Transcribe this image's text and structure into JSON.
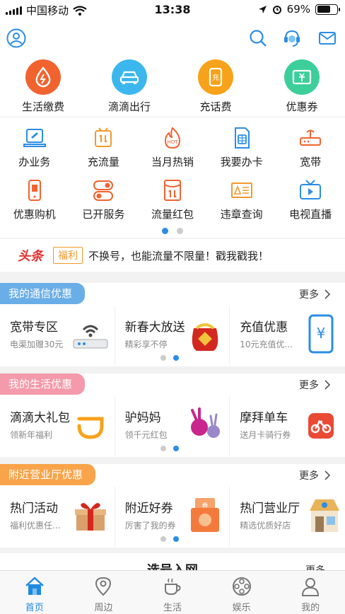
{
  "status_bar": {
    "carrier": "中国移动",
    "time": "13:38",
    "battery": "69%",
    "battery_level": 0.69
  },
  "header": {
    "profile_icon": "user-circle-icon",
    "search_icon": "search-icon",
    "service_icon": "customer-service-icon",
    "mail_icon": "mail-icon"
  },
  "top_services": [
    {
      "label": "生活缴费",
      "icon": "water-drop-icon",
      "color": "#f0632f"
    },
    {
      "label": "滴滴出行",
      "icon": "car-icon",
      "color": "#3cb7ee"
    },
    {
      "label": "充话费",
      "icon": "recharge-icon",
      "color": "#f7a21b"
    },
    {
      "label": "优惠券",
      "icon": "coupon-icon",
      "color": "#3ccf9a"
    }
  ],
  "grid": {
    "row1": [
      {
        "label": "办业务",
        "icon": "business-icon"
      },
      {
        "label": "充流量",
        "icon": "data-recharge-icon"
      },
      {
        "label": "当月热销",
        "icon": "hot-sale-icon"
      },
      {
        "label": "我要办卡",
        "icon": "sim-card-icon"
      },
      {
        "label": "宽带",
        "icon": "router-icon"
      }
    ],
    "row2": [
      {
        "label": "优惠购机",
        "icon": "phone-icon"
      },
      {
        "label": "已开服务",
        "icon": "toggle-icon"
      },
      {
        "label": "流量红包",
        "icon": "red-packet-icon"
      },
      {
        "label": "违章查询",
        "icon": "traffic-icon"
      },
      {
        "label": "电视直播",
        "icon": "tv-icon"
      }
    ]
  },
  "news": {
    "logo": "头条",
    "tag": "福利",
    "text": "不换号，也能流量不限量！戳我戳我！"
  },
  "sections": [
    {
      "title": "我的通信优惠",
      "more": "更多",
      "color": "#6aaee8",
      "cards": [
        {
          "title": "宽带专区",
          "subtitle": "电渠加赠30元",
          "image": "router-icon"
        },
        {
          "title": "新春大放送",
          "subtitle": "精彩享不停",
          "image": "gift-bag-icon"
        },
        {
          "title": "充值优惠",
          "subtitle": "10元充值优...",
          "image": "phone-yuan-icon"
        }
      ]
    },
    {
      "title": "我的生活优惠",
      "more": "更多",
      "color": "#f49aaa",
      "cards": [
        {
          "title": "滴滴大礼包",
          "subtitle": "领新年福利",
          "image": "didi-logo-icon"
        },
        {
          "title": "驴妈妈",
          "subtitle": "领千元红包",
          "image": "donkey-icon"
        },
        {
          "title": "摩拜单车",
          "subtitle": "送月卡骑行券",
          "image": "bike-icon"
        }
      ]
    },
    {
      "title": "附近营业厅优惠",
      "more": "更多",
      "color": "#f9a44a",
      "cards": [
        {
          "title": "热门活动",
          "subtitle": "福利优惠任...",
          "image": "gift-box-icon"
        },
        {
          "title": "附近好券",
          "subtitle": "厉害了我的券",
          "image": "voucher-icon"
        },
        {
          "title": "热门营业厅",
          "subtitle": "精选优质好店",
          "image": "store-icon"
        }
      ]
    }
  ],
  "partial_section": {
    "title": "选号入网",
    "more": "更多"
  },
  "tabs": [
    {
      "label": "首页",
      "icon": "home-icon",
      "active": true
    },
    {
      "label": "周边",
      "icon": "location-icon",
      "active": false
    },
    {
      "label": "生活",
      "icon": "coffee-icon",
      "active": false
    },
    {
      "label": "娱乐",
      "icon": "film-reel-icon",
      "active": false
    },
    {
      "label": "我的",
      "icon": "person-icon",
      "active": false
    }
  ]
}
